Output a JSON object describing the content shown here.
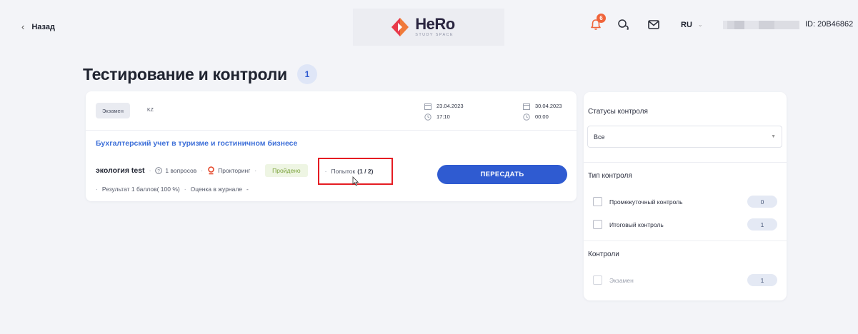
{
  "header": {
    "back_label": "Назад",
    "logo_brand": "HeRo",
    "logo_sub": "STUDY SPACE",
    "notifications_count": "6",
    "language": "RU",
    "user_id": "ID: 20B46862",
    "colors": {
      "accent": "#2f5bd1",
      "badge": "#f0643a",
      "logo_red": "#e8394a",
      "logo_orange": "#f07a3a"
    }
  },
  "page": {
    "title": "Тестирование и контроли",
    "count": "1"
  },
  "test_card": {
    "tag_type": "Экзамен",
    "tag_lang": "KZ",
    "start_date": "23.04.2023",
    "start_time": "17:10",
    "end_date": "30.04.2023",
    "end_time": "00:00",
    "course_title": "Бухгалтерский учет в туризме и гостиничном бизнесе",
    "test_name": "экология test",
    "questions": "1 вопросов",
    "proctoring": "Прокторинг",
    "status": "Пройдено",
    "attempts_label": "Попыток",
    "attempts_value": "(1 / 2)",
    "result": "Результат 1 баллов( 100 %)",
    "journal_grade": "Оценка в журнале",
    "journal_value": "-",
    "retake_label": "ПЕРЕСДАТЬ"
  },
  "filters": {
    "status_title": "Статусы контроля",
    "status_selected": "Все",
    "type_title": "Тип контроля",
    "types": [
      {
        "label": "Промежуточный контроль",
        "count": "0"
      },
      {
        "label": "Итоговый контроль",
        "count": "1"
      }
    ],
    "controls_title": "Контроли",
    "controls": [
      {
        "label": "Экзамен",
        "count": "1"
      }
    ]
  }
}
